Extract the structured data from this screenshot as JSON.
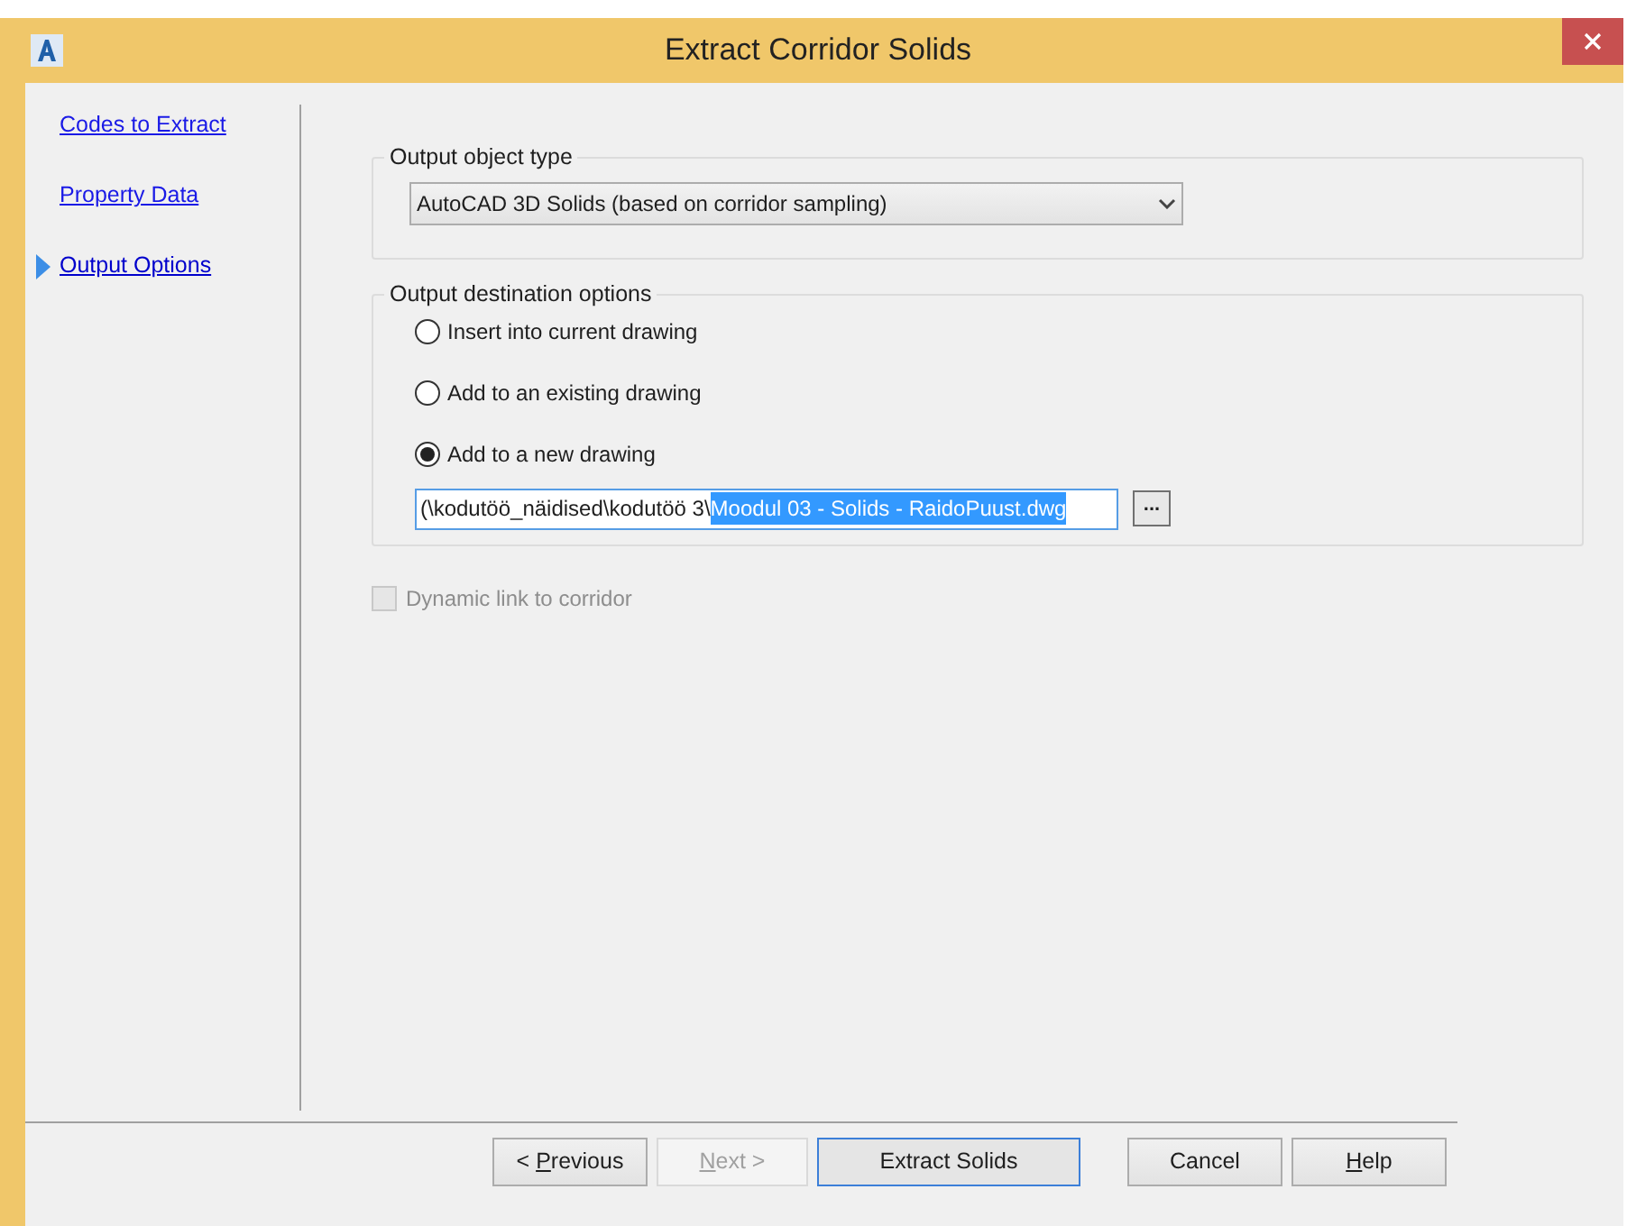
{
  "window": {
    "title": "Extract Corridor Solids"
  },
  "sidebar": {
    "items": [
      {
        "label": "Codes to Extract",
        "selected": false
      },
      {
        "label": "Property Data",
        "selected": false
      },
      {
        "label": "Output Options",
        "selected": true
      }
    ]
  },
  "output_object_type": {
    "legend": "Output object type",
    "value": "AutoCAD 3D Solids (based on corridor sampling)"
  },
  "output_destination": {
    "legend": "Output destination options",
    "options": [
      {
        "label": "Insert into current drawing",
        "selected": false
      },
      {
        "label": "Add to an existing drawing",
        "selected": false
      },
      {
        "label": "Add to a new drawing",
        "selected": true
      }
    ],
    "path": {
      "value": "(\\kodutöö_näidised\\kodutöö 3\\",
      "selected_value": "Moodul 03 - Solids - RaidoPuust.dwg"
    },
    "browse_button": "..."
  },
  "dynamic_link": {
    "label": "Dynamic link to corridor",
    "checked": false,
    "disabled": true
  },
  "buttons": [
    {
      "before": "< ",
      "key": "P",
      "after": "revious",
      "disabled": false,
      "default": false
    },
    {
      "key": "N",
      "after": "ext >",
      "disabled": true,
      "default": false
    },
    {
      "before": "Extract Solids",
      "disabled": false,
      "default": true
    },
    {
      "before": "Cancel",
      "disabled": false,
      "default": false
    },
    {
      "key": "H",
      "after": "elp",
      "disabled": false,
      "default": false
    }
  ]
}
